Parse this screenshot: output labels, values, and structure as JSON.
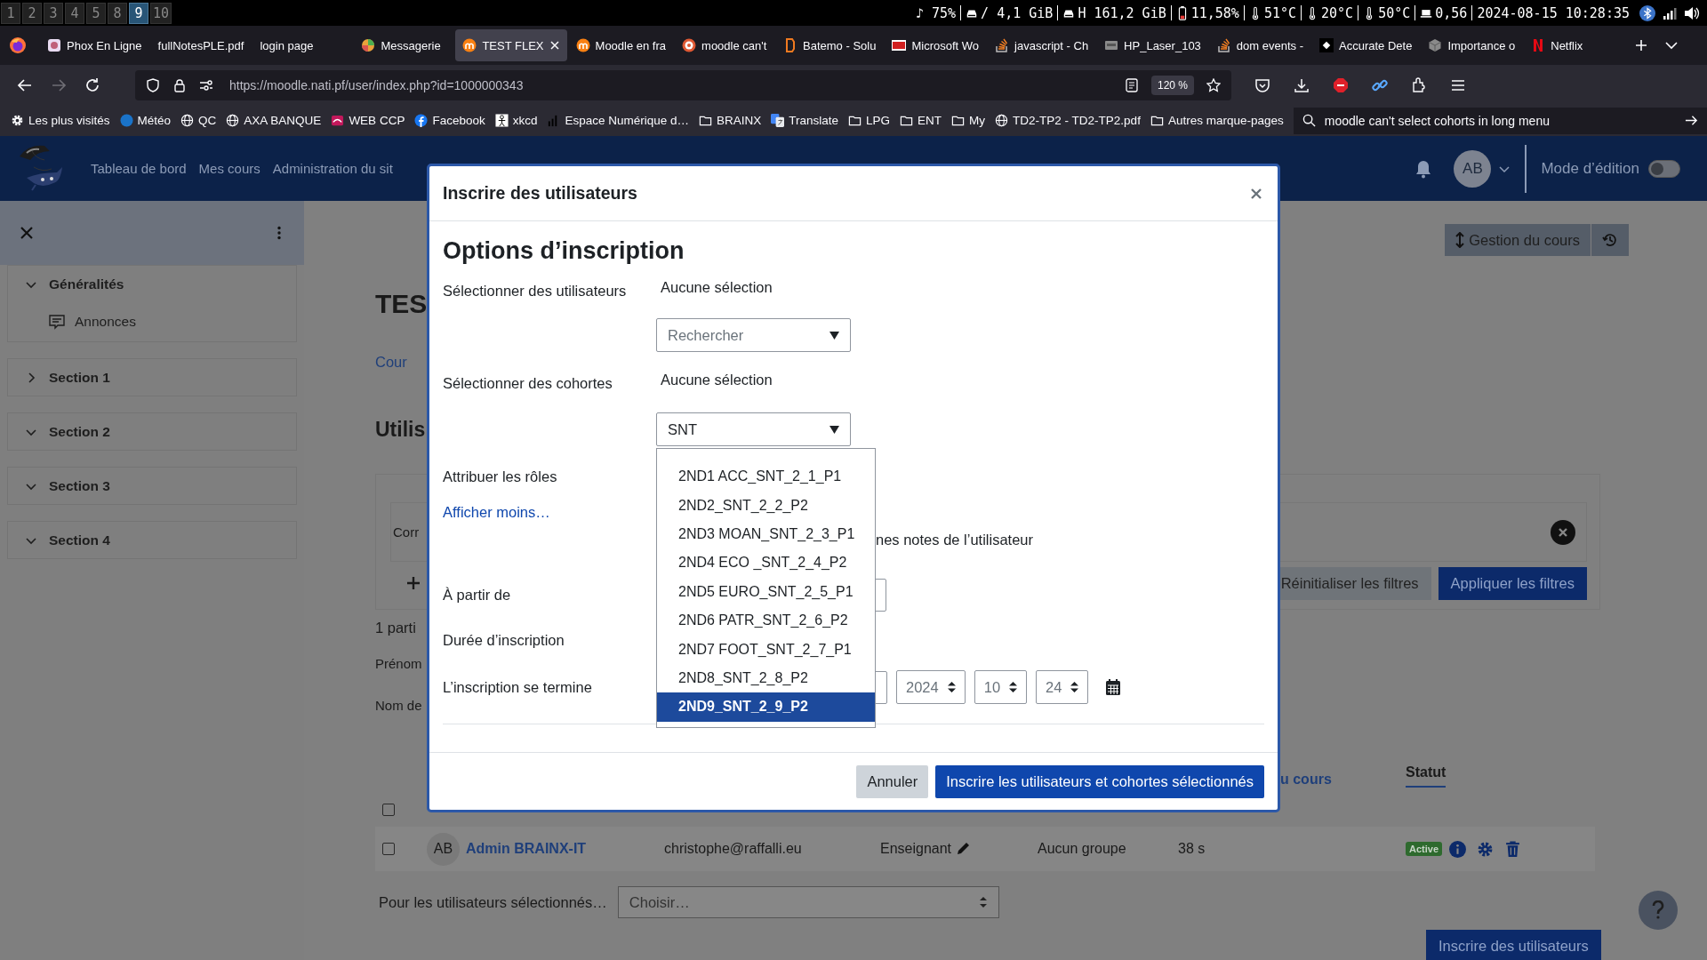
{
  "system_bar": {
    "workspaces": [
      {
        "label": "1",
        "selected": false
      },
      {
        "label": "2",
        "selected": false
      },
      {
        "label": "3",
        "selected": false
      },
      {
        "label": "4",
        "selected": false
      },
      {
        "label": "5",
        "selected": false
      },
      {
        "label": "8",
        "selected": false
      },
      {
        "label": "9",
        "selected": true
      },
      {
        "label": "10",
        "selected": false
      }
    ],
    "status": [
      {
        "kind": "text",
        "text": "♪ 75%"
      },
      {
        "kind": "disk",
        "text": "/ 4,1 GiB"
      },
      {
        "kind": "disk",
        "text": "H 161,2 GiB"
      },
      {
        "kind": "battery",
        "text": "11,58%"
      },
      {
        "kind": "temp",
        "text": "51°C"
      },
      {
        "kind": "temp",
        "text": "20°C"
      },
      {
        "kind": "temp",
        "text": "50°C"
      },
      {
        "kind": "load",
        "text": "0,56"
      },
      {
        "kind": "text",
        "text": "2024-08-15 10:28:35"
      }
    ]
  },
  "browser": {
    "tabs": [
      {
        "title": "Phox En Ligne",
        "kind": "phox",
        "selected": false
      },
      {
        "title": "fullNotesPLE.pdf",
        "kind": "plain",
        "selected": false
      },
      {
        "title": "login page",
        "kind": "plain",
        "selected": false
      },
      {
        "title": "Messagerie",
        "kind": "messagerie",
        "selected": false
      },
      {
        "title": "TEST FLEX",
        "kind": "moodle",
        "selected": true
      },
      {
        "title": "Moodle en fra",
        "kind": "moodle",
        "selected": false
      },
      {
        "title": "moodle can't",
        "kind": "ddg",
        "selected": false
      },
      {
        "title": "Batemo - Solu",
        "kind": "batemo",
        "selected": false
      },
      {
        "title": "Microsoft Wo",
        "kind": "iop",
        "selected": false
      },
      {
        "title": "javascript - Ch",
        "kind": "stack",
        "selected": false
      },
      {
        "title": "HP_Laser_103",
        "kind": "cups",
        "selected": false
      },
      {
        "title": "dom events -",
        "kind": "stack",
        "selected": false
      },
      {
        "title": "Accurate Dete",
        "kind": "w",
        "selected": false
      },
      {
        "title": "Importance o",
        "kind": "cube",
        "selected": false
      },
      {
        "title": "Netflix",
        "kind": "netflix",
        "selected": false
      }
    ],
    "nav_buttons": [
      {
        "kind": "back",
        "disabled": false
      },
      {
        "kind": "forward",
        "disabled": true
      },
      {
        "kind": "reload",
        "disabled": false
      }
    ],
    "url": "https://moodle.nati.pf/user/index.php?id=1000000343",
    "zoom": "120 %",
    "bookmarks": [
      {
        "label": "Les plus visités",
        "kind": "gear"
      },
      {
        "label": "Météo",
        "kind": "meteo"
      },
      {
        "label": "QC",
        "kind": "globe"
      },
      {
        "label": "AXA BANQUE",
        "kind": "globe"
      },
      {
        "label": "WEB CCP",
        "kind": "ccp"
      },
      {
        "label": "Facebook",
        "kind": "facebook"
      },
      {
        "label": "xkcd",
        "kind": "xkcd"
      },
      {
        "label": "Espace Numérique d…",
        "kind": "ent"
      },
      {
        "label": "BRAINX",
        "kind": "folder"
      },
      {
        "label": "Translate",
        "kind": "translate"
      },
      {
        "label": "LPG",
        "kind": "folder"
      },
      {
        "label": "ENT",
        "kind": "folder"
      },
      {
        "label": "My",
        "kind": "folder"
      },
      {
        "label": "TD2-TP2 - TD2-TP2.pdf",
        "kind": "globe"
      },
      {
        "label": "Autres marque-pages",
        "kind": "folder"
      }
    ],
    "search": {
      "value": "moodle can't select cohorts in long menu"
    }
  },
  "header": {
    "nav": [
      "Tableau de bord",
      "Mes cours",
      "Administration du sit"
    ],
    "avatar": "AB",
    "edit_mode": {
      "label": "Mode d’édition",
      "on": false
    }
  },
  "sidebar": {
    "sections": [
      {
        "title": "Généralités",
        "expanded": true,
        "children": [
          {
            "title": "Annonces"
          }
        ]
      },
      {
        "title": "Section 1",
        "expanded": false
      },
      {
        "title": "Section 2",
        "expanded": true
      },
      {
        "title": "Section 3",
        "expanded": true
      },
      {
        "title": "Section 4",
        "expanded": true
      }
    ]
  },
  "page": {
    "course_management": "Gestion du cours",
    "course_title": "TES",
    "nav_link": "Cour",
    "heading": "Utilis",
    "filter_text": "Corr",
    "reset_filters": "Réinitialiser les filtres",
    "apply_filters": "Appliquer les filtres",
    "count_text": "1 parti",
    "first_name_label": "Prénom",
    "last_name_label": "Nom de",
    "table": {
      "columns": [
        {
          "label": "u cours"
        },
        {
          "label": "Statut"
        }
      ],
      "header_checked": false,
      "rows": [
        {
          "checked": false,
          "initials": "AB",
          "name": "Admin BRAINX-IT",
          "email": "christophe@raffalli.eu",
          "role": "Enseignant",
          "group": "Aucun groupe",
          "last_access": "38 s",
          "status": "Active"
        }
      ]
    },
    "bulk": {
      "label": "Pour les utilisateurs sélectionnés…",
      "placeholder": "Choisir…"
    },
    "enrol_button": "Inscrire des utilisateurs"
  },
  "modal": {
    "title": "Inscrire des utilisateurs",
    "heading": "Options d’inscription",
    "users": {
      "label": "Sélectionner des utilisateurs",
      "selection": "Aucune sélection",
      "placeholder": "Rechercher"
    },
    "cohorts": {
      "label": "Sélectionner des cohortes",
      "selection": "Aucune sélection",
      "value": "SNT"
    },
    "options": [
      {
        "label": "2ND1 ACC_SNT_2_1_P1",
        "selected": false
      },
      {
        "label": "2ND2_SNT_2_2_P2",
        "selected": false
      },
      {
        "label": "2ND3 MOAN_SNT_2_3_P1",
        "selected": false
      },
      {
        "label": "2ND4 ECO _SNT_2_4_P2",
        "selected": false
      },
      {
        "label": "2ND5 EURO_SNT_2_5_P1",
        "selected": false
      },
      {
        "label": "2ND6 PATR_SNT_2_6_P2",
        "selected": false
      },
      {
        "label": "2ND7 FOOT_SNT_2_7_P1",
        "selected": false
      },
      {
        "label": "2ND8_SNT_2_8_P2",
        "selected": false
      },
      {
        "label": "2ND9_SNT_2_9_P2",
        "selected": true
      }
    ],
    "roles_label": "Attribuer les rôles",
    "show_less": "Afficher moins…",
    "grades_text": "nes notes de l’utilisateur",
    "start_label": "À partir de",
    "duration_label": "Durée d’inscription",
    "end_label": "L’inscription se termine",
    "end_date": [
      "2024",
      "10",
      "24"
    ],
    "cancel": "Annuler",
    "submit": "Inscrire les utilisateurs et cohortes sélectionnés"
  }
}
